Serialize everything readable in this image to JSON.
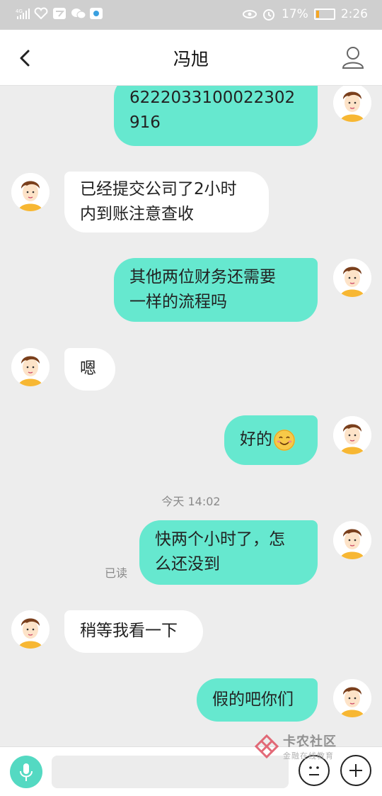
{
  "status_bar": {
    "network": "4G",
    "battery": "17%",
    "battery_level": 0.17,
    "time": "2:26"
  },
  "header": {
    "title": "冯旭"
  },
  "messages": [
    {
      "side": "out",
      "text": "6222033100022302\n916"
    },
    {
      "side": "in",
      "text": "已经提交公司了2小时\n内到账注意查收"
    },
    {
      "side": "out",
      "text": "其他两位财务还需要\n一样的流程吗"
    },
    {
      "side": "in",
      "text": "嗯"
    },
    {
      "side": "out",
      "text": "好的",
      "emoji": "smile-emoji"
    },
    {
      "side": "out",
      "text": "快两个小时了，怎\n么还没到",
      "status": "已读"
    },
    {
      "side": "in",
      "text": "稍等我看一下"
    },
    {
      "side": "out",
      "text": "假的吧你们"
    }
  ],
  "timestamp": "今天 14:02",
  "watermark": {
    "title": "卡农社区",
    "subtitle": "金融在线教育"
  },
  "colors": {
    "outgoing_bubble": "#66e8cf",
    "incoming_bubble": "#ffffff",
    "mic_button": "#54d9c2"
  }
}
